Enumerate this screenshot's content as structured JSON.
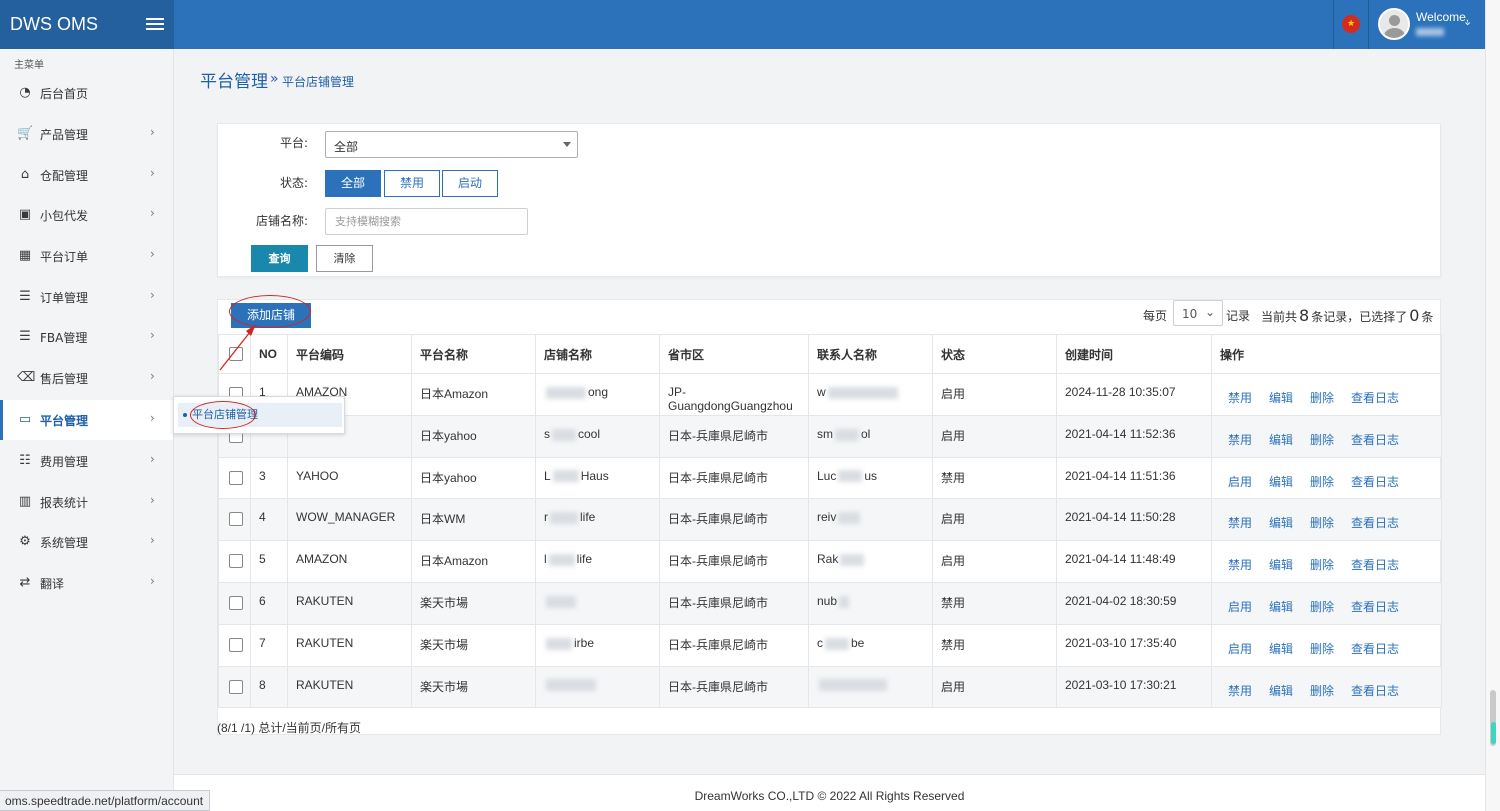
{
  "app": {
    "brand": "DWS OMS"
  },
  "header": {
    "welcome": "Welcome,"
  },
  "sidebar": {
    "title": "主菜单",
    "items": [
      {
        "label": "后台首页",
        "icon": "dashboard-icon"
      },
      {
        "label": "产品管理",
        "icon": "cart-icon"
      },
      {
        "label": "仓配管理",
        "icon": "home-icon"
      },
      {
        "label": "小包代发",
        "icon": "package-icon"
      },
      {
        "label": "平台订单",
        "icon": "table-icon"
      },
      {
        "label": "订单管理",
        "icon": "list-icon"
      },
      {
        "label": "FBA管理",
        "icon": "list-icon"
      },
      {
        "label": "售后管理",
        "icon": "backspace-icon"
      },
      {
        "label": "平台管理",
        "icon": "monitor-icon"
      },
      {
        "label": "费用管理",
        "icon": "list-ordered-icon"
      },
      {
        "label": "报表统计",
        "icon": "bar-chart-icon"
      },
      {
        "label": "系统管理",
        "icon": "gear-icon"
      },
      {
        "label": "翻译",
        "icon": "translate-icon"
      }
    ],
    "flyout_item": "平台店铺管理"
  },
  "page": {
    "title": "平台管理",
    "breadcrumb_sep": "»",
    "breadcrumb": "平台店铺管理"
  },
  "filter": {
    "platform_label": "平台:",
    "platform_value": "全部",
    "status_label": "状态:",
    "status_options": [
      "全部",
      "禁用",
      "启动"
    ],
    "store_label": "店铺名称:",
    "store_placeholder": "支持模糊搜索",
    "query_button": "查询",
    "clear_button": "清除"
  },
  "toolbar": {
    "add_button": "添加店铺",
    "per_page_label": "每页",
    "per_page_value": "10",
    "records_label": "记录",
    "summary_prefix": "当前共",
    "total": "8",
    "summary_mid": "条记录，已选择了",
    "selected": "0",
    "summary_suffix": "条"
  },
  "table": {
    "columns": [
      "NO",
      "平台编码",
      "平台名称",
      "店铺名称",
      "省市区",
      "联系人名称",
      "状态",
      "创建时间",
      "操作"
    ],
    "rows": [
      {
        "no": "1",
        "code": "AMAZON",
        "platform": "日本Amazon",
        "store_a": "",
        "store_b": "ong",
        "region": "JP-GuangdongGuangzhou",
        "contact_a": "w",
        "contact_b": "",
        "status": "启用",
        "created": "2024-11-28 10:35:07",
        "toggle": "禁用"
      },
      {
        "no": "",
        "code": "",
        "platform": "日本yahoo",
        "store_a": "s",
        "store_b": "cool",
        "region": "日本-兵庫県尼崎市",
        "contact_a": "sm",
        "contact_b": "ol",
        "status": "启用",
        "created": "2021-04-14 11:52:36",
        "toggle": "禁用"
      },
      {
        "no": "3",
        "code": "YAHOO",
        "platform": "日本yahoo",
        "store_a": "L",
        "store_b": "Haus",
        "region": "日本-兵庫県尼崎市",
        "contact_a": "Luc",
        "contact_b": "us",
        "status": "禁用",
        "created": "2021-04-14 11:51:36",
        "toggle": "启用"
      },
      {
        "no": "4",
        "code": "WOW_MANAGER",
        "platform": "日本WM",
        "store_a": "r",
        "store_b": "life",
        "region": "日本-兵庫県尼崎市",
        "contact_a": "reiv",
        "contact_b": "",
        "status": "启用",
        "created": "2021-04-14 11:50:28",
        "toggle": "禁用"
      },
      {
        "no": "5",
        "code": "AMAZON",
        "platform": "日本Amazon",
        "store_a": "l",
        "store_b": "life",
        "region": "日本-兵庫県尼崎市",
        "contact_a": "Rak",
        "contact_b": "",
        "status": "启用",
        "created": "2021-04-14 11:48:49",
        "toggle": "禁用"
      },
      {
        "no": "6",
        "code": "RAKUTEN",
        "platform": "楽天市場",
        "store_a": "",
        "store_b": "",
        "region": "日本-兵庫県尼崎市",
        "contact_a": "nub",
        "contact_b": "",
        "status": "禁用",
        "created": "2021-04-02 18:30:59",
        "toggle": "启用"
      },
      {
        "no": "7",
        "code": "RAKUTEN",
        "platform": "楽天市場",
        "store_a": "",
        "store_b": "irbe",
        "region": "日本-兵庫県尼崎市",
        "contact_a": "c",
        "contact_b": "be",
        "status": "禁用",
        "created": "2021-03-10 17:35:40",
        "toggle": "启用"
      },
      {
        "no": "8",
        "code": "RAKUTEN",
        "platform": "楽天市場",
        "store_a": "",
        "store_b": "",
        "region": "日本-兵庫県尼崎市",
        "contact_a": "",
        "contact_b": "",
        "status": "启用",
        "created": "2021-03-10 17:30:21",
        "toggle": "禁用"
      }
    ],
    "op_edit": "编辑",
    "op_delete": "删除",
    "op_log": "查看日志"
  },
  "pager": {
    "info": "(8/1 /1) 总计/当前页/所有页"
  },
  "footer": {
    "text": "DreamWorks CO.,LTD © 2022 All Rights Reserved"
  },
  "status_bar": {
    "url": "oms.speedtrade.net/platform/account"
  },
  "colors": {
    "primary": "#2b72bb",
    "brand_bg": "#245f9e",
    "query_button": "#1a87ad",
    "annotation": "#d0261f"
  }
}
